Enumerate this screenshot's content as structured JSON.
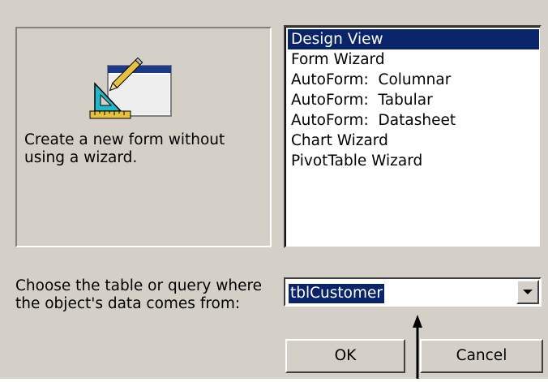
{
  "dialog": {
    "description": "Create a new form without using a wizard.",
    "preview_icon": "design-view-form-icon",
    "views": [
      "Design View",
      "Form Wizard",
      "AutoForm:  Columnar",
      "AutoForm:  Tabular",
      "AutoForm:  Datasheet",
      "Chart Wizard",
      "PivotTable Wizard"
    ],
    "selected_view": "Design View",
    "source_label": "Choose the table or query where the object's data comes from:",
    "source_value": "tblCustomer",
    "ok_label": "OK",
    "cancel_label": "Cancel"
  },
  "annotation": {
    "icon": "up-arrow-icon"
  },
  "colors": {
    "dialog_background": "#d4d0c8",
    "selection_background": "#0a246a",
    "selection_text": "#ffffff"
  }
}
